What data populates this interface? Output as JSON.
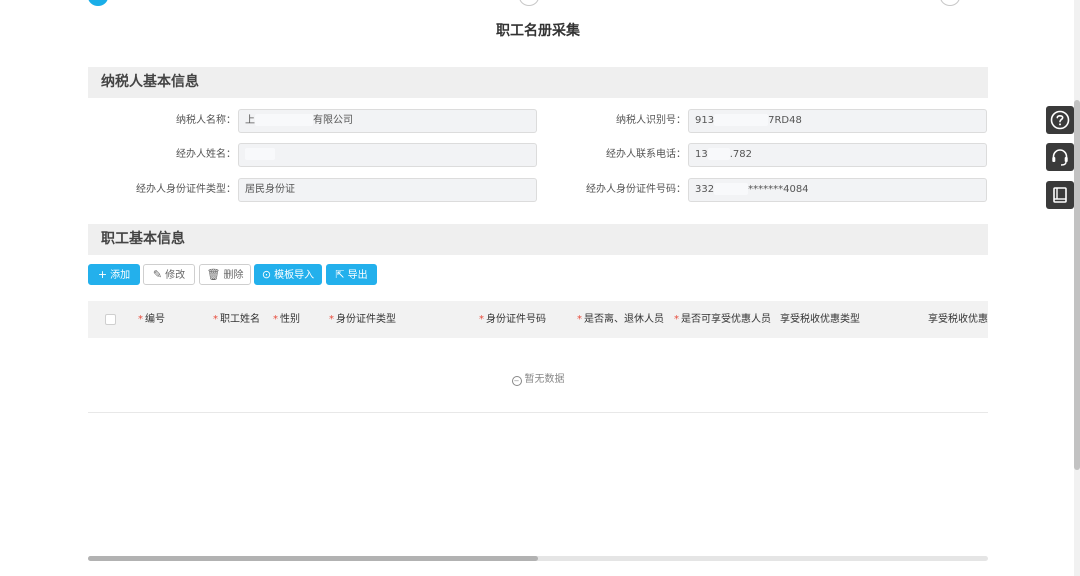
{
  "page_title": "职工名册采集",
  "taxpayer_section": {
    "title": "纳税人基本信息",
    "fields": [
      {
        "label": "纳税人名称：",
        "value_start": "上",
        "value_end": "有限公司"
      },
      {
        "label": "纳税人识别号：",
        "value_start": "913",
        "value_end": "7RD48"
      },
      {
        "label": "经办人姓名：",
        "value_start": "",
        "value_end": ""
      },
      {
        "label": "经办人联系电话：",
        "value_start": "13",
        "value_end": ".782"
      },
      {
        "label": "经办人身份证件类型：",
        "value_start": "居民身份证",
        "value_end": ""
      },
      {
        "label": "经办人身份证件号码：",
        "value_start": "332",
        "value_end": "*******4084"
      }
    ]
  },
  "employee_section": {
    "title": "职工基本信息",
    "toolbar": {
      "add": "添加",
      "edit": "修改",
      "delete": "删除",
      "import": "模板导入",
      "export": "导出"
    },
    "table": {
      "columns": [
        {
          "label": "编号",
          "required": true
        },
        {
          "label": "职工姓名",
          "required": true
        },
        {
          "label": "性别",
          "required": true
        },
        {
          "label": "身份证件类型",
          "required": true
        },
        {
          "label": "身份证件号码",
          "required": true
        },
        {
          "label": "是否离、退休人员",
          "required": true
        },
        {
          "label": "是否可享受优惠人员",
          "required": true
        },
        {
          "label": "享受税收优惠类型",
          "required": false
        },
        {
          "label": "享受税收优惠证",
          "required": false
        }
      ],
      "empty_text": "暂无数据"
    }
  },
  "side_tools": [
    {
      "name": "help",
      "icon": "question-icon"
    },
    {
      "name": "service",
      "icon": "headset-icon"
    },
    {
      "name": "manual",
      "icon": "book-icon"
    }
  ],
  "colors": {
    "primary": "#23b0ec",
    "required": "#e74c3c",
    "section_bg": "#efefef"
  }
}
